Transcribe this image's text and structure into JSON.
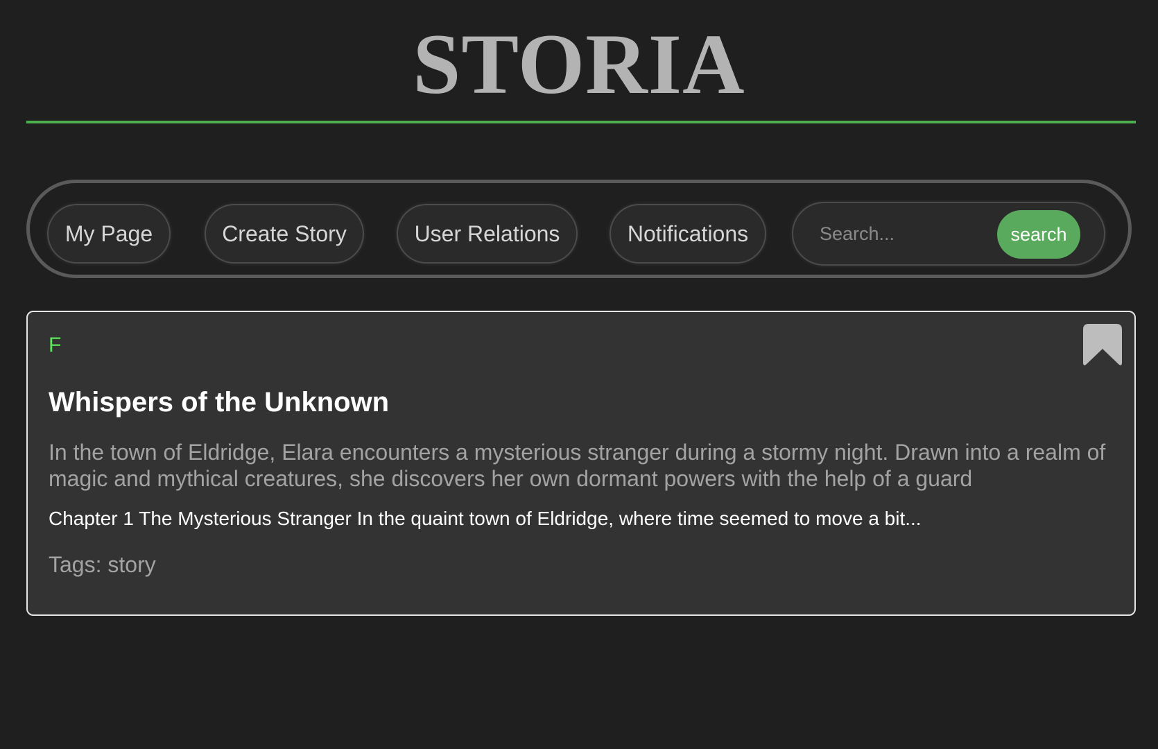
{
  "site": {
    "title": "STORIA"
  },
  "nav": {
    "my_page": "My Page",
    "create_story": "Create Story",
    "user_relations": "User Relations",
    "notifications": "Notifications"
  },
  "search": {
    "placeholder": "Search...",
    "value": "",
    "button_label": "search"
  },
  "story": {
    "author_initial": "F",
    "title": "Whispers of the Unknown",
    "summary": "In the town of Eldridge, Elara encounters a mysterious stranger during a stormy night. Drawn into a realm of magic and mythical creatures, she discovers her own dormant powers with the help of a guard",
    "excerpt": "Chapter 1 The Mysterious Stranger In the quaint town of Eldridge, where time seemed to move a bit...",
    "tags_text": "Tags: story",
    "bookmark_icon": "bookmark-icon"
  },
  "colors": {
    "background": "#1f1f1f",
    "accent_green": "#4caf50",
    "search_button": "#5aaa5e",
    "author_initial": "#5ee65e",
    "card_background": "#333333",
    "title_gray": "#b3b3b3"
  }
}
